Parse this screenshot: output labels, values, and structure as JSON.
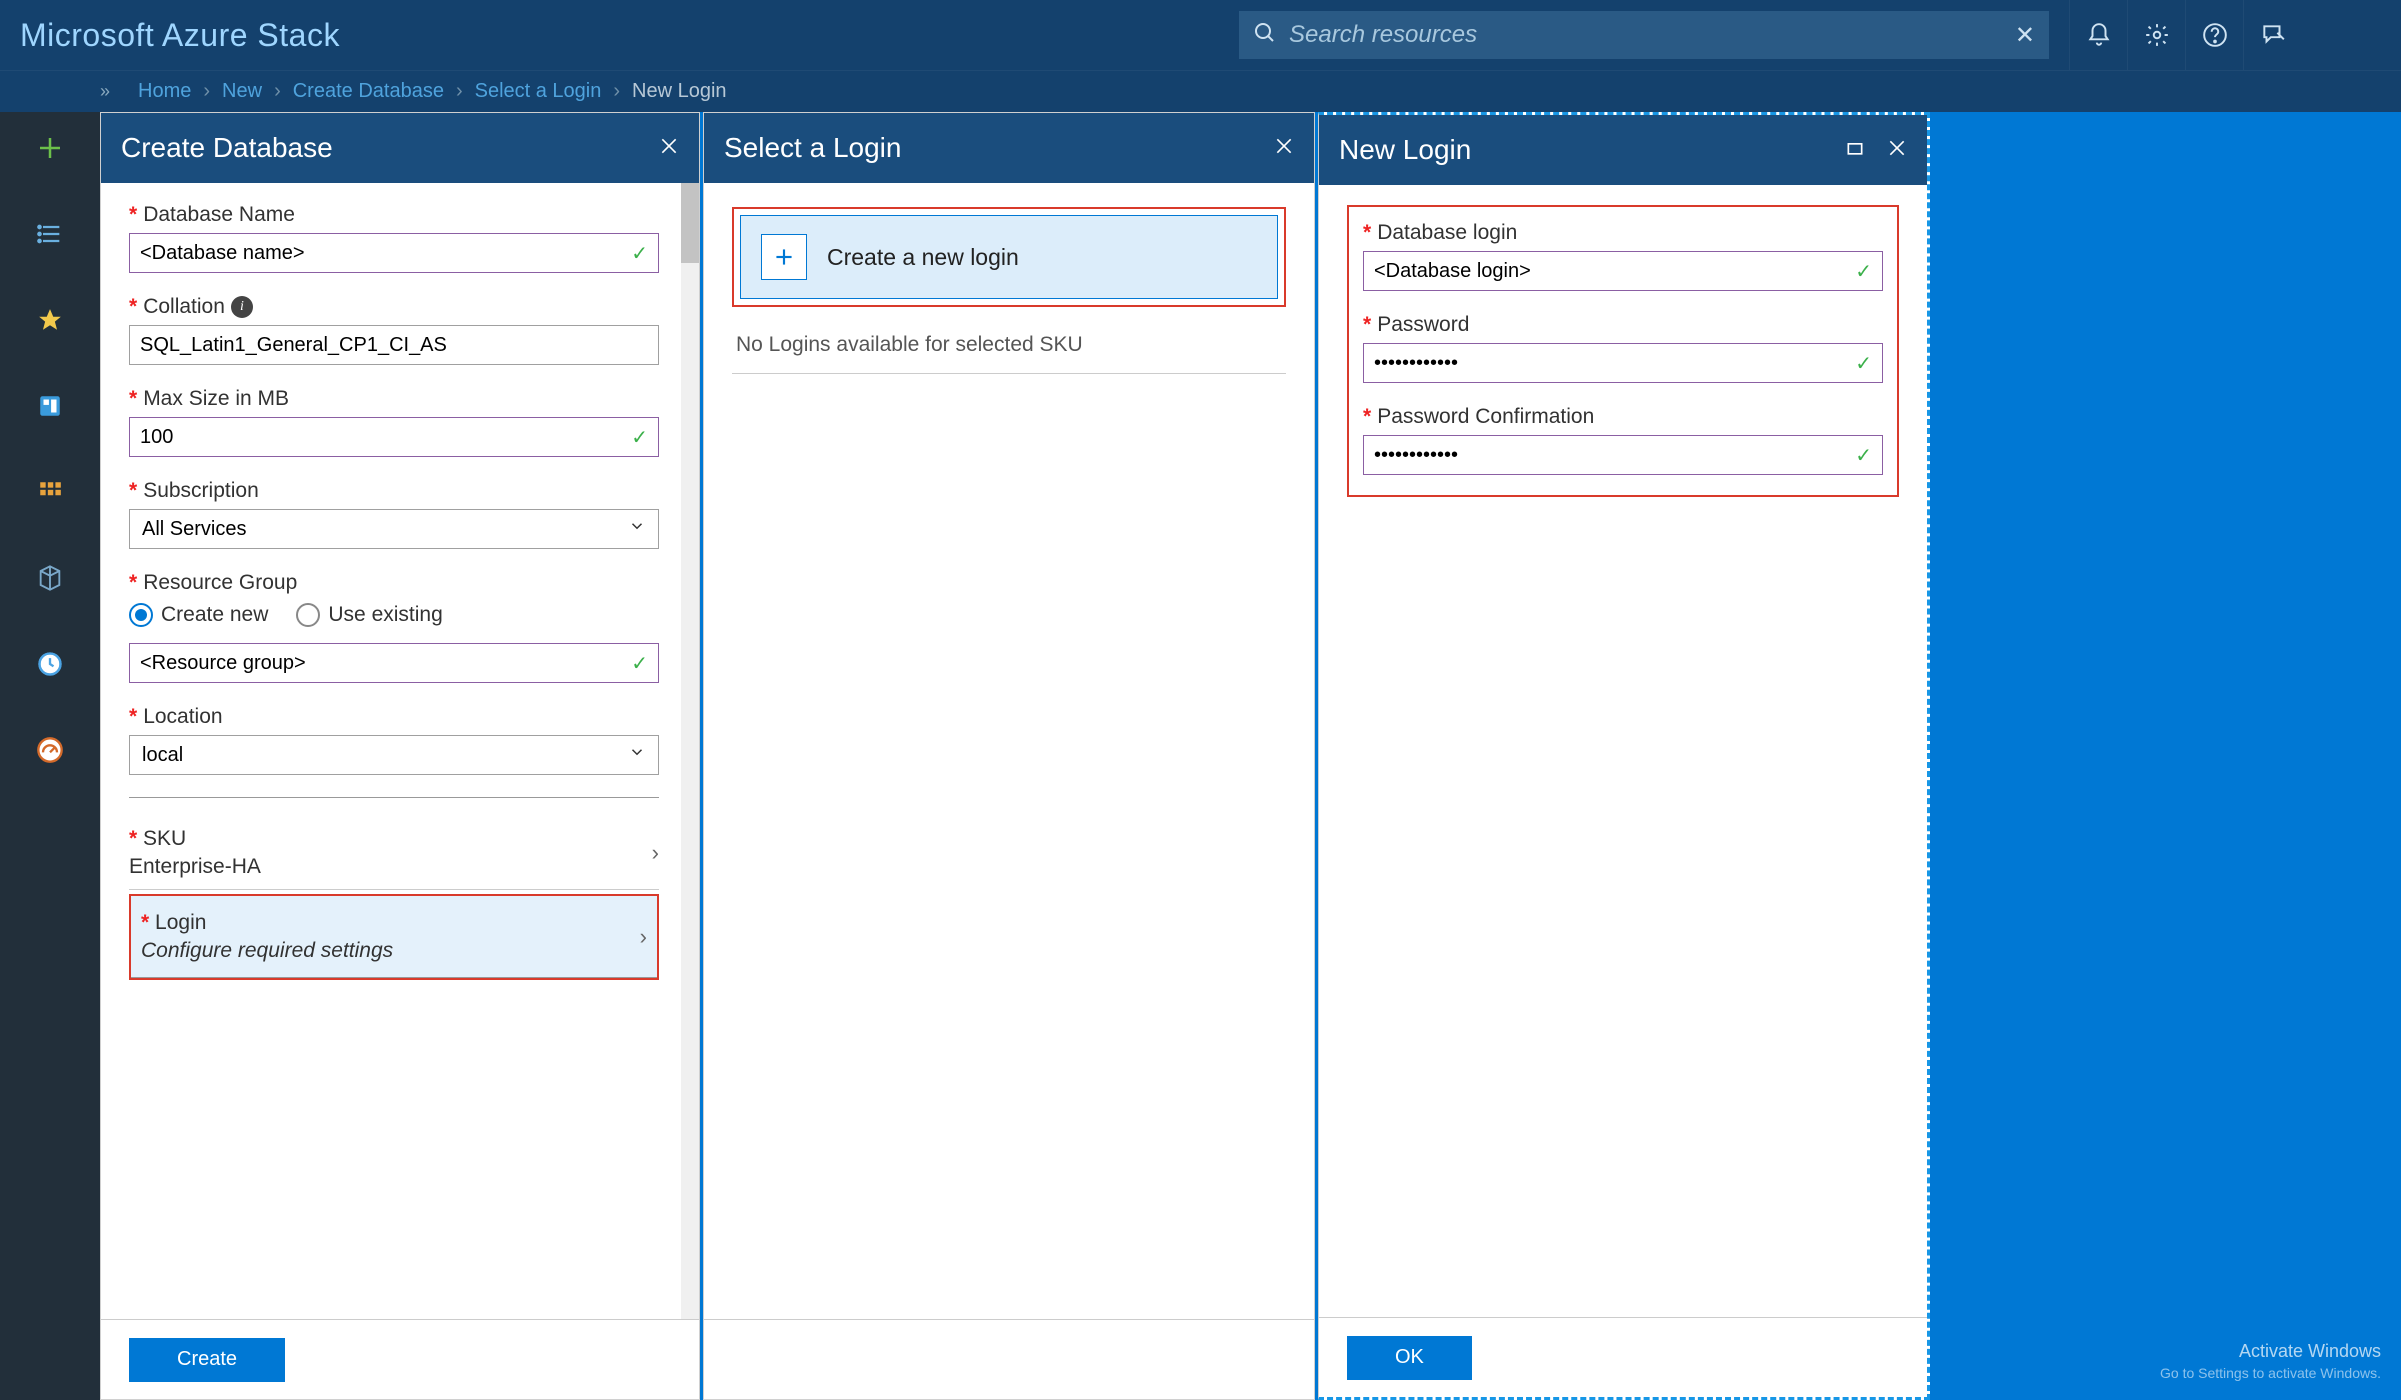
{
  "topbar": {
    "brand": "Microsoft Azure Stack",
    "search_placeholder": "Search resources"
  },
  "breadcrumbs": {
    "items": [
      "Home",
      "New",
      "Create Database",
      "Select a Login",
      "New Login"
    ]
  },
  "blade1": {
    "title": "Create Database",
    "db_name_label": "Database Name",
    "db_name_value": "<Database name>",
    "collation_label": "Collation",
    "collation_value": "SQL_Latin1_General_CP1_CI_AS",
    "max_size_label": "Max Size in MB",
    "max_size_value": "100",
    "subscription_label": "Subscription",
    "subscription_value": "All Services",
    "rg_label": "Resource Group",
    "rg_create_label": "Create new",
    "rg_existing_label": "Use existing",
    "rg_value": "<Resource group>",
    "location_label": "Location",
    "location_value": "local",
    "sku_label": "SKU",
    "sku_value": "Enterprise-HA",
    "login_label": "Login",
    "login_sub": "Configure required settings",
    "create_btn": "Create"
  },
  "blade2": {
    "title": "Select a Login",
    "create_text": "Create a new login",
    "empty_text": "No Logins available for selected SKU"
  },
  "blade3": {
    "title": "New Login",
    "login_label": "Database login",
    "login_value": "<Database login>",
    "pwd_label": "Password",
    "pwd_value": "••••••••••••",
    "pwd2_label": "Password Confirmation",
    "pwd2_value": "••••••••••••",
    "ok_btn": "OK"
  },
  "watermark": {
    "line1": "Activate Windows",
    "line2": "Go to Settings to activate Windows."
  }
}
